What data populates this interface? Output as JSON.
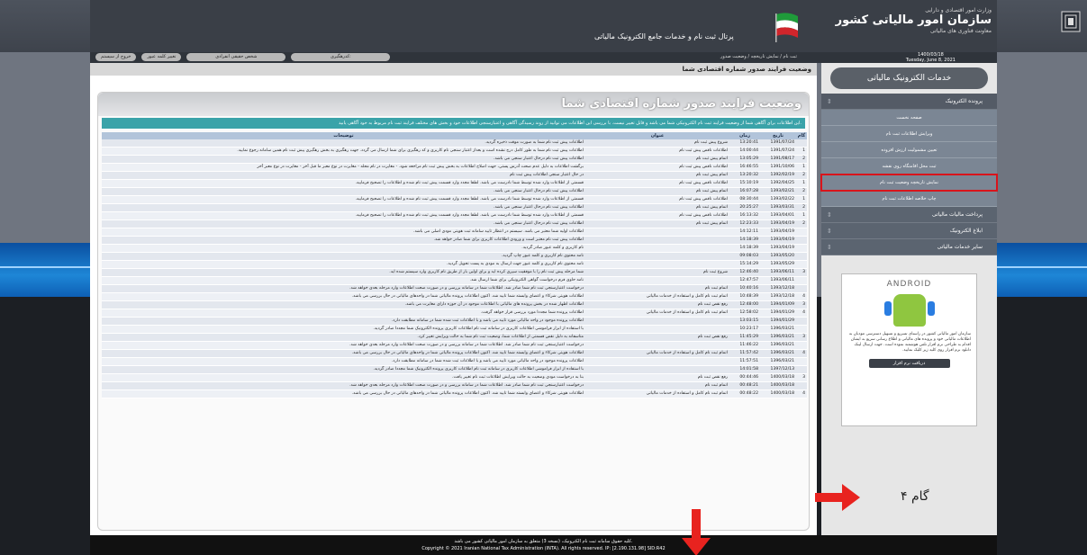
{
  "header": {
    "ministry": "وزارت امور اقتصادی و دارایی",
    "org_title": "سازمان امور مالیاتی کشور",
    "org_sub": "معاونت فناوری های مالیاتی",
    "portal": "پرتال ثبت نام و خدمات جامع الکترونیک مالیاتی",
    "date_persian": "1400/03/18",
    "date_gregorian": "Tuesday, June 8, 2021",
    "breadcrumb": "ثبت نام / نمایش تاریخچه / وضعیت صدور",
    "user_label": "کدرهگیری:",
    "user_type": "شخص حقیقی انفرادی",
    "change_pass": "تغییر کلمه عبور",
    "logout": "خروج از سیستم"
  },
  "main": {
    "page_title": "وضعیت فرایند صدور شماره اقتصادی شما",
    "panel_title": "وضعیت فرایند صدور شماره اقتصادی شما",
    "notice": "این اطلاعات برای آگاهی شما از وضعیت فرایند ثبت نام الکترونیکی شما می باشد و قابل تغییر نیست. با بررسی این اطلاعات می توانید از روند رسیدگی آگاهی و اعتبارسنجی اطلاعات خود و بخش های مختلف فرایند ثبت نام مربوط به خود آگاهی یابید.",
    "columns": [
      "گام",
      "تاریخ",
      "زمان",
      "عنوان",
      "توضیحات"
    ],
    "rows": [
      [
        "",
        "1391/07/24",
        "13:20:41",
        "شروع پیش ثبت نام",
        "اطلاعات پیش ثبت نام شما به صورت موقت ذخیره گردید."
      ],
      [
        "1",
        "1391/07/24",
        "14:00:44",
        "اطلاعات ناقص پیش ثبت نام",
        "اطلاعات پیش ثبت نام شما به طور کامل درج نشده است و بعداز اعتبار سنجی نام کاربری و کد رهگیری برای شما ارسال می گردد. جهت رهگیری به بخش رهگیری پیش ثبت نام همین سامانه رجوع نمایید."
      ],
      [
        "2",
        "1391/08/17",
        "13:05:29",
        "اتمام پیش ثبت نام",
        "اطلاعات پیش ثبت نام درحال اعتبار سنجی می باشد."
      ],
      [
        "1",
        "1391/10/06",
        "16:46:55",
        "اطلاعات ناقص پیش ثبت نام",
        "برگشت اطلاعات به دلیل عدم صحت آدرس پستی، جهت اصلاح اطلاعات به بخش پیش ثبت نام مراجعه شود. - مغایرت در نام محله - مغایرت در نوع معبر ما قبل آخر - مغایرت در نوع معبر آخر"
      ],
      [
        "2",
        "1392/02/19",
        "13:20:32",
        "اتمام پیش ثبت نام",
        "در حال اعتبار سنجی اطلاعات پیش ثبت نام"
      ],
      [
        "1",
        "1392/04/25",
        "15:10:19",
        "اطلاعات ناقص پیش ثبت نام",
        "قسمتی از اطلاعات وارد شده توسط شما نادرست می باشد. لطفا مجدد وارد قسمت پیش ثبت نام شده و اطلاعات را تصحیح فرمایید."
      ],
      [
        "2",
        "1393/02/21",
        "16:07:28",
        "اتمام پیش ثبت نام",
        "اطلاعات پیش ثبت نام درحال اعتبار سنجی می باشد."
      ],
      [
        "1",
        "1393/02/22",
        "08:30:44",
        "اطلاعات ناقص پیش ثبت نام",
        "قسمتی از اطلاعات وارد شده توسط شما نادرست می باشد. لطفا مجدد وارد قسمت پیش ثبت نام شده و اطلاعات را تصحیح فرمایید."
      ],
      [
        "2",
        "1393/03/31",
        "20:25:27",
        "اتمام پیش ثبت نام",
        "اطلاعات پیش ثبت نام درحال اعتبار سنجی می باشد."
      ],
      [
        "1",
        "1393/04/01",
        "16:13:32",
        "اطلاعات ناقص پیش ثبت نام",
        "قسمتی از اطلاعات وارد شده توسط شما نادرست می باشد. لطفا مجدد وارد قسمت پیش ثبت نام شده و اطلاعات را تصحیح فرمایید."
      ],
      [
        "2",
        "1393/04/19",
        "12:23:33",
        "اتمام پیش ثبت نام",
        "اطلاعات پیش ثبت نام درحال اعتبار سنجی می باشد."
      ],
      [
        "",
        "1393/04/19",
        "14:12:11",
        "",
        "اطلاعات اولیه شما معتبر می باشد. سیستم در انتظار تایید سامانه ثبت هویتی مودی اصلی می باشد."
      ],
      [
        "",
        "1393/04/19",
        "14:18:39",
        "",
        "اطلاعات پیش ثبت نام معتبر است و ورودی اطلاعات کاربری برای شما صادر خواهد شد."
      ],
      [
        "",
        "1393/04/19",
        "14:18:39",
        "",
        "نام کاربری و کلمه عبور صادر گردید."
      ],
      [
        "",
        "1393/05/20",
        "09:08:03",
        "",
        "نامه محتوی نام کاربری و کلمه عبور چاپ گردید."
      ],
      [
        "",
        "1393/05/29",
        "15:14:29",
        "",
        "نامه محتوی نام کاربری و کلمه عبور جهت ارسال به مودی به پست تحویل گردید."
      ],
      [
        "3",
        "1393/06/11",
        "12:46:40",
        "شروع ثبت نام",
        "شما مرحله پیش ثبت نام را با موفقیت سپری کرده اید و برای اولین بار از طریق نام کاربری وارد سیستم شده اید."
      ],
      [
        "",
        "1393/06/11",
        "12:47:57",
        "",
        "نامه حاوی فرم درخواست گواهی الکترونیکی برای شما ارسال شد."
      ],
      [
        "",
        "1393/12/18",
        "10:40:16",
        "اتمام ثبت نام",
        "درخواست اعتبارسنجی ثبت نام شما صادر شد. اطلاعات شما در سامانه بررسی و در صورت صحت اطلاعات وارد مرحله بعدی خواهد شد."
      ],
      [
        "4",
        "1393/12/18",
        "10:48:39",
        "اتمام ثبت نام کامل و استفاده از خدمات مالیاتی",
        "اطلاعات هویتی شرکاء و اعضای وابسته شما تایید شد. اکنون اطلاعات پرونده مالیاتی شما در واحدهای مالیاتی در حال بررسی می باشد."
      ],
      [
        "3",
        "1394/01/09",
        "12:48:00",
        "رفع نقص ثبت نام",
        "اطلاعات اظهار شده در بخش پرونده های مالیاتی با اطلاعات موجود در آن حوزه دارای مغایرت می باشد."
      ],
      [
        "4",
        "1394/01/29",
        "12:58:02",
        "اتمام ثبت نام کامل و استفاده از خدمات مالیاتی",
        "اطلاعات پرونده شما مجددا مورد بررسی قرار خواهد گرفت."
      ],
      [
        "",
        "1394/01/29",
        "13:03:15",
        "",
        "اطلاعات پرونده موجود در واحد مالیاتی مورد تایید می باشد و با اطلاعات ثبت شده شما در سامانه مطابقت دارد."
      ],
      [
        "",
        "1396/03/21",
        "10:23:17",
        "",
        "با استفاده از ابزار فراموشی اطلاعات کاربری در سامانه ثبت نام اطلاعات کاربری پرونده الکترونیک شما مجددا صادر گردید."
      ],
      [
        "3",
        "1396/03/21",
        "11:45:29",
        "رفع نقص ثبت نام",
        "متاسفانه به دلیل نقص قسمتی از اطلاعات شما، وضعیت ثبت نام شما به حالت ویرایش تغییر کرد."
      ],
      [
        "",
        "1396/03/21",
        "11:46:22",
        "",
        "درخواست اعتبارسنجی ثبت نام شما صادر شد. اطلاعات شما در سامانه بررسی و در صورت صحت اطلاعات وارد مرحله بعدی خواهد شد."
      ],
      [
        "4",
        "1396/03/21",
        "11:57:42",
        "اتمام ثبت نام کامل و استفاده از خدمات مالیاتی",
        "اطلاعات هویتی شرکاء و اعضای وابسته شما تایید شد. اکنون اطلاعات پرونده مالیاتی شما در واحدهای مالیاتی در حال بررسی می باشد."
      ],
      [
        "",
        "1396/03/21",
        "11:57:51",
        "",
        "اطلاعات پرونده موجود در واحد مالیاتی مورد تایید می باشد و با اطلاعات ثبت شده شما در سامانه مطابقت دارد."
      ],
      [
        "",
        "1397/12/13",
        "14:01:58",
        "",
        "با استفاده از ابزار فراموشی اطلاعات کاربری در سامانه ثبت نام اطلاعات کاربری پرونده الکترونیک شما مجددا صادر گردید."
      ],
      [
        "3",
        "1400/03/18",
        "00:44:46",
        "رفع نقص ثبت نام",
        "بنا به درخواست مودی وضعیت به حالت ویرایش اطلاعات ثبت نام تغییر یافت."
      ],
      [
        "",
        "1400/03/18",
        "00:48:21",
        "اتمام ثبت نام",
        "درخواست اعتبارسنجی ثبت نام شما صادر شد. اطلاعات شما در سامانه بررسی و در صورت صحت اطلاعات وارد مرحله بعدی خواهد شد."
      ],
      [
        "4",
        "1400/03/18",
        "00:48:22",
        "اتمام ثبت نام کامل و استفاده از خدمات مالیاتی",
        "اطلاعات هویتی شرکاء و اعضای وابسته شما تایید شد. اکنون اطلاعات پرونده مالیاتی شما در واحدهای مالیاتی در حال بررسی می باشد."
      ]
    ]
  },
  "sidebar": {
    "logo": "خدمات الکترونیک مالیاتی",
    "section_head": "پرونده الکترونیک",
    "items": [
      "صفحه نخست",
      "ویرایش اطلاعات ثبت نام",
      "تعیین مشمولیت ارزش افزوده",
      "ثبت محل اقامتگاه روی نقشه",
      "نمایش تاریخچه وضعیت ثبت نام",
      "چاپ خلاصه اطلاعات ثبت نام"
    ],
    "sections": [
      "پرداخت مالیات مالیاتی",
      "ابلاغ الکترونیک",
      "سایر خدمات مالیاتی"
    ],
    "app_brand": "ANDROID",
    "app_text": "سازمان امور مالیاتی کشور در راستای تسریع و تسهیل دسترسی مودیان به اطلاعات مالیاتی خود و پرونده های مالیاتی و اطلاع رسانی سریع به ایشان اقدام به طراحی نرم افزار تلفن هوشمند نموده است. جهت ارسال لینک دانلود نرم افزار روی کلید زیر کلیک نمایید.",
    "app_button": "دریافت نرم افزار"
  },
  "annotation": {
    "step_label": "گام ۴"
  },
  "footer": {
    "line1": "کلیه حقوق سامانه ثبت نام الکترونیک، (نسخه 3) متعلق به سازمان امور مالیاتی کشور می باشد.",
    "line2": "Copyright © 2021 Iranian National Tax Administration (INTA). All rights reserved. IP: [2.190.131.98] SID:R42"
  },
  "colors": {
    "accent_red": "#d9141b",
    "notice_teal": "#3aa3a9",
    "sidebar_blue": "#5b6470"
  }
}
